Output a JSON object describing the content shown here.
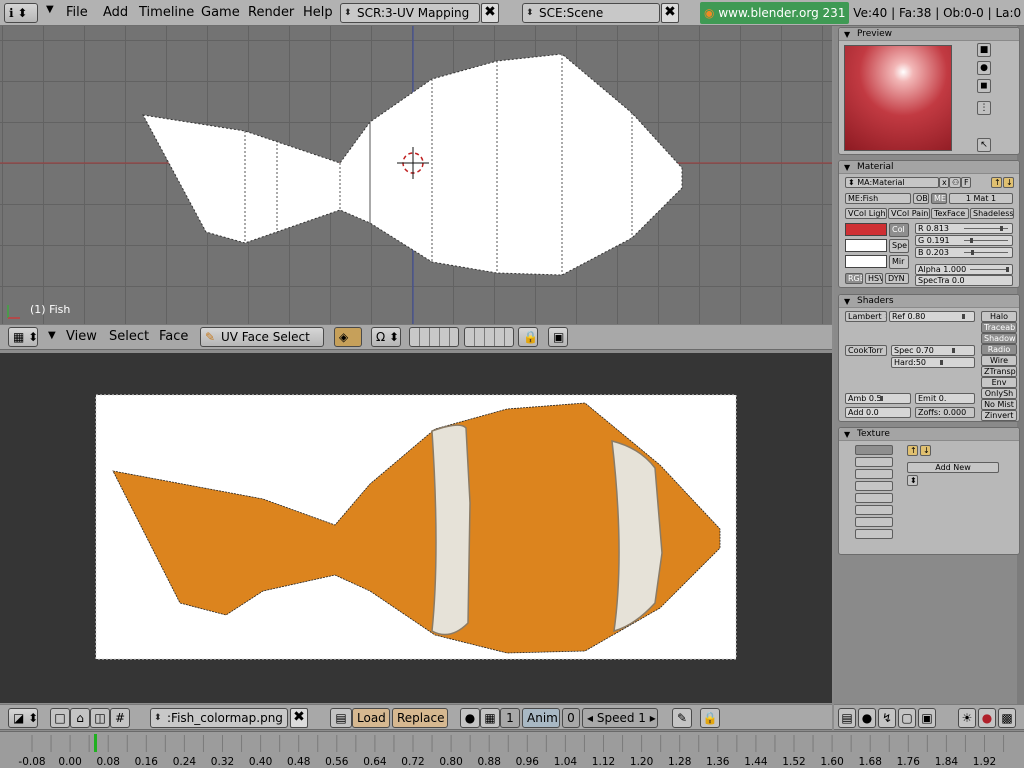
{
  "topbar": {
    "menu": [
      "File",
      "Add",
      "Timeline",
      "Game",
      "Render",
      "Help"
    ],
    "screen": "SCR:3-UV Mapping",
    "scene": "SCE:Scene",
    "website": "www.blender.org 231",
    "stats": "Ve:40 | Fa:38 | Ob:0-0 | La:0",
    "close_glyph": "✖"
  },
  "view3d": {
    "object_label": "(1) Fish",
    "header": {
      "menus": [
        "View",
        "Select",
        "Face"
      ],
      "mode": "UV Face Select"
    }
  },
  "image_editor": {
    "header": {
      "image_name": ":Fish_colormap.png",
      "load": "Load",
      "replace": "Replace",
      "frame_a": "1",
      "anim": "Anim",
      "frame_b": "0",
      "speed": "Speed 1"
    }
  },
  "timeline": {
    "ticks": [
      "-0.08",
      "0.00",
      "0.08",
      "0.16",
      "0.24",
      "0.32",
      "0.40",
      "0.48",
      "0.56",
      "0.64",
      "0.72",
      "0.80",
      "0.88",
      "0.96",
      "1.04",
      "1.12",
      "1.20",
      "1.28",
      "1.36",
      "1.44",
      "1.52",
      "1.60",
      "1.68",
      "1.76",
      "1.84",
      "1.92"
    ],
    "current_frame_value": "0.08"
  },
  "panels": {
    "preview": {
      "title": "Preview"
    },
    "material": {
      "title": "Material",
      "ma_name": "MA:Material",
      "me_name": "ME:Fish",
      "ob": "OB",
      "me": "ME",
      "mat_index": "1 Mat 1",
      "toggles": [
        "VCol Ligh",
        "VCol Pain",
        "TexFace",
        "Shadeless"
      ],
      "col_labels": [
        "Col",
        "Spe",
        "Mir"
      ],
      "r": "R 0.813",
      "g": "G 0.191",
      "b": "B 0.203",
      "alpha": "Alpha 1.000",
      "spectra": "SpecTra 0.0",
      "mode_btns": [
        "RGB",
        "HSV",
        "DYN"
      ],
      "colors": {
        "col": "#cf3034",
        "spe": "#ffffff",
        "mir": "#ffffff"
      }
    },
    "shaders": {
      "title": "Shaders",
      "diffuse": "Lambert",
      "ref": "Ref 0.80",
      "specular": "CookTorr",
      "spec": "Spec 0.70",
      "hard": "Hard:50",
      "amb": "Amb 0.5",
      "emit": "Emit 0.",
      "add": "Add 0.0",
      "zoffs": "Zoffs: 0.000",
      "flags": [
        "Halo",
        "Traceabl",
        "Shadow",
        "Radio",
        "Wire",
        "ZTransp",
        "Env",
        "OnlySh",
        "No Mist",
        "Zinvert"
      ]
    },
    "texture": {
      "title": "Texture",
      "add_new": "Add New"
    }
  },
  "colors": {
    "fish_orange": "#dc841e",
    "stripe": "#e6e2d8",
    "link_green": "#3f9a54"
  }
}
